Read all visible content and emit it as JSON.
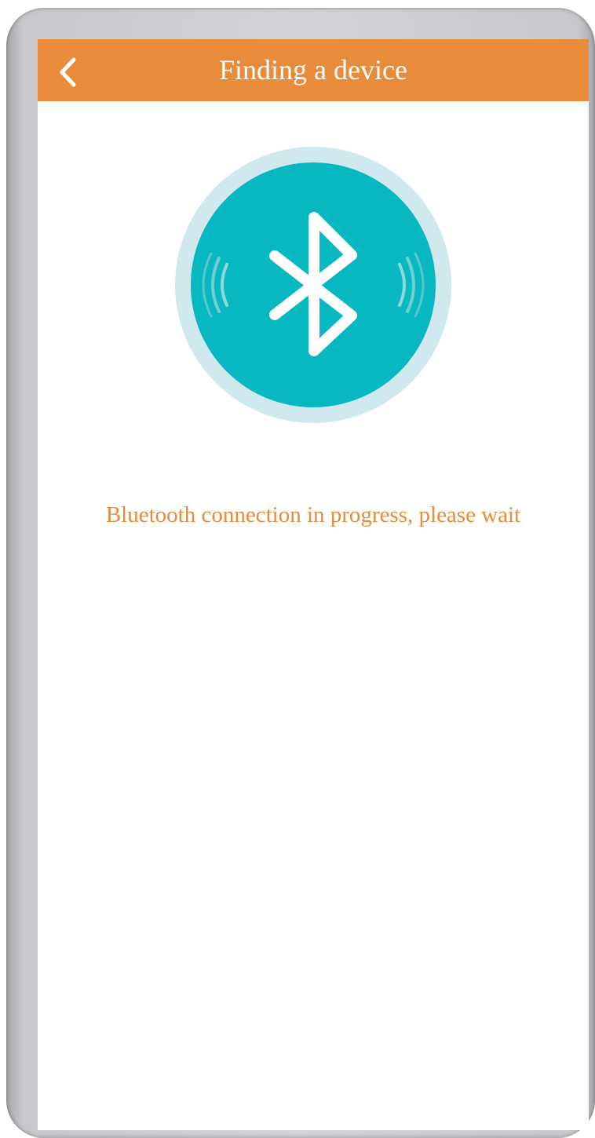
{
  "header": {
    "title": "Finding a device",
    "back_icon": "chevron-left-icon"
  },
  "main": {
    "status_text": "Bluetooth connection in progress, please wait",
    "bluetooth_icon": "bluetooth-icon",
    "signal_icons": [
      "signal-waves-left-icon",
      "signal-waves-right-icon"
    ]
  },
  "colors": {
    "header_bg": "#e88b3a",
    "accent_text": "#e88b3a",
    "circle_inner": "#07b8c1",
    "circle_outer": "#cfe9ef",
    "frame": "#c9c9cd"
  }
}
